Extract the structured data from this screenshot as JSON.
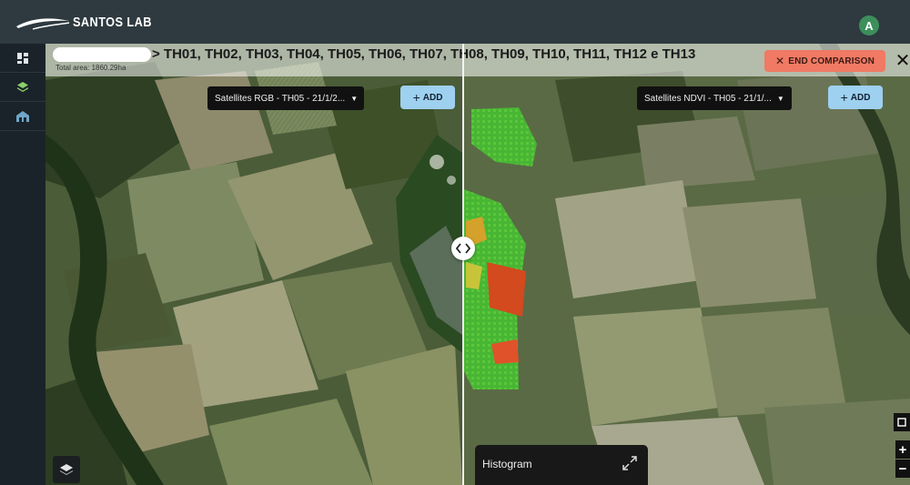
{
  "header": {
    "logo_text": "SANTOS LAB",
    "avatar_initial": "A"
  },
  "sidebar": {
    "items": [
      {
        "icon": "dashboard-grid-icon"
      },
      {
        "icon": "layers-icon"
      },
      {
        "icon": "farm-icon"
      }
    ]
  },
  "title_bar": {
    "area_title": "> TH01, TH02, TH03, TH04, TH05, TH06, TH07, TH08, TH09, TH10, TH11, TH12 e TH13",
    "total_area": "Total area: 1860.29ha",
    "end_comparison_label": "END COMPARISON",
    "close_symbol": "✕"
  },
  "left_panel": {
    "layer_select_value": "Satellites RGB - TH05 - 21/1/2...",
    "add_label": "ADD"
  },
  "right_panel": {
    "layer_select_value": "Satellites NDVI - TH05 - 21/1/...",
    "add_label": "ADD"
  },
  "histogram": {
    "label": "Histogram"
  },
  "map_controls": {
    "zoom_in": "+",
    "zoom_out": "−"
  },
  "colors": {
    "end_comparison": "#f07a64",
    "add_button": "#9ed0ef",
    "avatar": "#3c8f5a",
    "topbar": "#2e3a40"
  }
}
